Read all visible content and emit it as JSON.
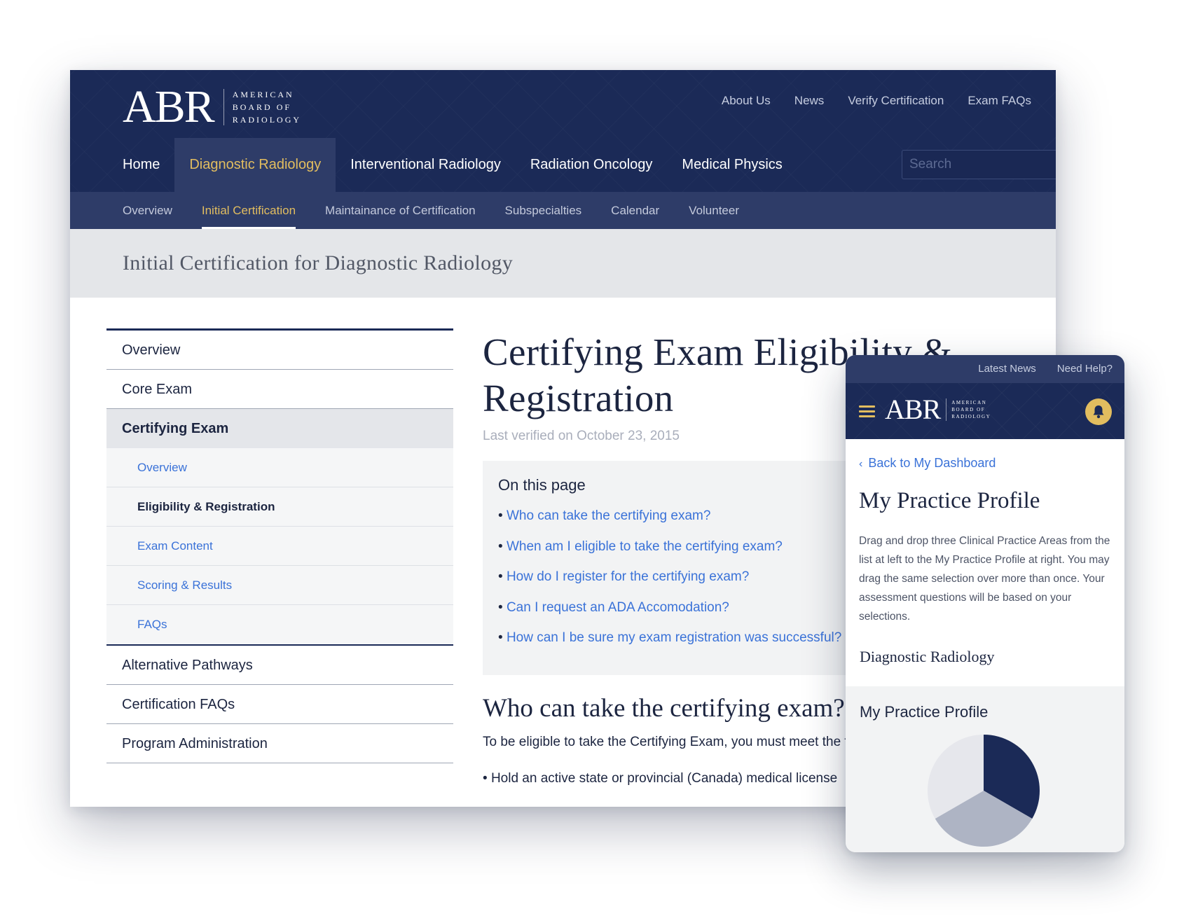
{
  "desktop": {
    "logo": {
      "mark": "ABR",
      "words": [
        "AMERICAN",
        "BOARD OF",
        "RADIOLOGY"
      ]
    },
    "utility_nav": [
      "About Us",
      "News",
      "Verify Certification",
      "Exam FAQs"
    ],
    "main_nav": [
      {
        "label": "Home",
        "active": false
      },
      {
        "label": "Diagnostic Radiology",
        "active": true
      },
      {
        "label": "Interventional Radiology",
        "active": false
      },
      {
        "label": "Radiation Oncology",
        "active": false
      },
      {
        "label": "Medical Physics",
        "active": false
      }
    ],
    "search": {
      "placeholder": "Search",
      "value": ""
    },
    "sub_nav": [
      {
        "label": "Overview",
        "active": false
      },
      {
        "label": "Initial Certification",
        "active": true
      },
      {
        "label": "Maintainance of Certification",
        "active": false
      },
      {
        "label": "Subspecialties",
        "active": false
      },
      {
        "label": "Calendar",
        "active": false
      },
      {
        "label": "Volunteer",
        "active": false
      }
    ],
    "page_title": "Initial Certification for Diagnostic Radiology",
    "side_menu": {
      "top": [
        "Overview",
        "Core Exam"
      ],
      "current": "Certifying Exam",
      "sub": [
        "Overview",
        "Eligibility & Registration",
        "Exam Content",
        "Scoring & Results",
        "FAQs"
      ],
      "current_sub": "Eligibility & Registration",
      "bottom": [
        "Alternative Pathways",
        "Certification FAQs",
        "Program Administration"
      ]
    },
    "article": {
      "title": "Certifying Exam Eligibility & Registration",
      "verified": "Last verified on October 23, 2015",
      "toc_title": "On this page",
      "toc_links": [
        "Who can take the certifying exam?",
        "When am I eligible to take the certifying exam?",
        "How do I register for the certifying exam?",
        "Can I request an ADA Accomodation?",
        "How can I be sure my exam registration was successful?"
      ],
      "section_heading": "Who can take the certifying exam?",
      "section_text": "To be eligible to take the Certifying Exam, you must meet the following requirements:",
      "bullet": "Hold an active state or provincial (Canada) medical license"
    }
  },
  "mobile": {
    "top_links": [
      "Latest News",
      "Need Help?"
    ],
    "logo": {
      "mark": "ABR",
      "words": [
        "AMERICAN",
        "BOARD OF",
        "RADIOLOGY"
      ]
    },
    "back_link": "Back to My Dashboard",
    "title": "My Practice Profile",
    "description": "Drag and drop three Clinical Practice Areas from the list at left to the My Practice Profile at right. You may drag the same selection over more than once. Your assessment questions will be based on your selections.",
    "section": "Diagnostic Radiology",
    "panel_title": "My Practice Profile"
  },
  "colors": {
    "navy": "#1b2a57",
    "nav_active_bg": "#2e3c68",
    "gold": "#e2bd5f",
    "link_blue": "#3a72d8"
  },
  "chart_data": {
    "type": "pie",
    "values": [
      1,
      1,
      1
    ],
    "colors": [
      "#1b2a57",
      "#aeb4c4",
      "#e6e7ec"
    ]
  }
}
